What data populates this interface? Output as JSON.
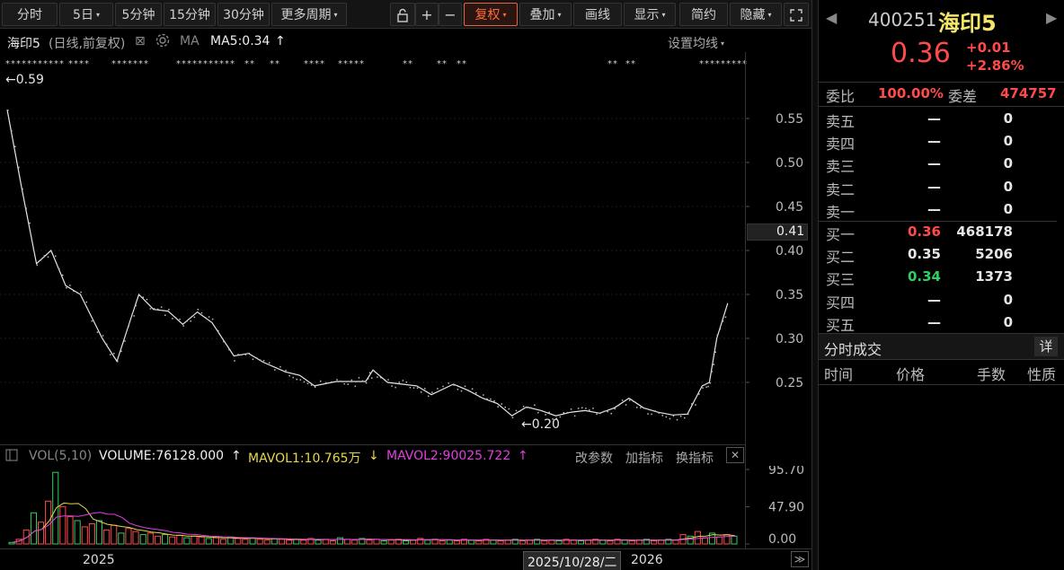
{
  "toolbar": {
    "items": [
      "分时",
      "5日",
      "5分钟",
      "15分钟",
      "30分钟",
      "更多周期",
      "复权",
      "叠加",
      "画线",
      "显示",
      "简约",
      "隐藏"
    ],
    "dropdown_marker": "▾",
    "lock_icon": "lock-icon",
    "plus": "+",
    "minus": "−",
    "fullscreen": "⛶"
  },
  "info": {
    "name": "海印5",
    "mode": "(日线,前复权)",
    "close_glyph": "⊠",
    "ma_label": "MA",
    "ma5": "MA5:0.34",
    "ma_arrow": "↑",
    "settings": "设置均线",
    "settings_arrow": "▾"
  },
  "markers": {
    "max_label": "←0.59",
    "min_label": "←0.20"
  },
  "price_axis": {
    "ticks": [
      "0.55",
      "0.50",
      "0.45",
      "0.40",
      "0.35",
      "0.30",
      "0.25"
    ],
    "current": "0.41"
  },
  "volume": {
    "label": "VOL(5,10)",
    "volume": "VOLUME:76128.000",
    "vol_arrow": "↑",
    "mavol1": "MAVOL1:10.765万",
    "mavol1_arrow": "↓",
    "mavol2": "MAVOL2:90025.722",
    "mavol2_arrow": "↑",
    "actions": [
      "改参数",
      "加指标",
      "换指标"
    ],
    "close": "✕",
    "ticks": [
      "95.70",
      "47.90",
      "0.00"
    ]
  },
  "dates": {
    "y1": "2025",
    "cursor": "2025/10/28/二",
    "y2": "2026",
    "next": "≫",
    "prev": "|"
  },
  "quote": {
    "code": "400251",
    "name": "海印5",
    "price": "0.36",
    "change": "+0.01",
    "change_pct": "+2.86%",
    "wb_label": "委比",
    "wb_value": "100.00%",
    "wc_label": "委差",
    "wc_value": "474757",
    "asks": [
      {
        "label": "卖五",
        "price": "—",
        "vol": "0"
      },
      {
        "label": "卖四",
        "price": "—",
        "vol": "0"
      },
      {
        "label": "卖三",
        "price": "—",
        "vol": "0"
      },
      {
        "label": "卖二",
        "price": "—",
        "vol": "0"
      },
      {
        "label": "卖一",
        "price": "—",
        "vol": "0"
      }
    ],
    "bids": [
      {
        "label": "买一",
        "price": "0.36",
        "vol": "468178"
      },
      {
        "label": "买二",
        "price": "0.35",
        "vol": "5206"
      },
      {
        "label": "买三",
        "price": "0.34",
        "vol": "1373"
      },
      {
        "label": "买四",
        "price": "—",
        "vol": "0"
      },
      {
        "label": "买五",
        "price": "—",
        "vol": "0"
      }
    ],
    "trades_title": "分时成交",
    "trades_detail": "详",
    "cols": [
      "时间",
      "价格",
      "手数",
      "性质"
    ],
    "nav_left": "◀",
    "nav_right": "▶"
  },
  "colors": {
    "up": "#ff4a4a",
    "down": "#2ed060",
    "accent": "#ff6b3a",
    "mavol1": "#e6d84a",
    "mavol2": "#e040e0"
  },
  "chart_data": {
    "type": "line",
    "ylim": [
      0.2,
      0.59
    ],
    "price_path": [
      [
        0.0,
        0.56
      ],
      [
        0.02,
        0.47
      ],
      [
        0.04,
        0.385
      ],
      [
        0.06,
        0.4
      ],
      [
        0.08,
        0.36
      ],
      [
        0.1,
        0.35
      ],
      [
        0.13,
        0.3
      ],
      [
        0.15,
        0.274
      ],
      [
        0.17,
        0.325
      ],
      [
        0.18,
        0.35
      ],
      [
        0.2,
        0.333
      ],
      [
        0.22,
        0.331
      ],
      [
        0.24,
        0.316
      ],
      [
        0.26,
        0.33
      ],
      [
        0.28,
        0.318
      ],
      [
        0.31,
        0.28
      ],
      [
        0.33,
        0.283
      ],
      [
        0.35,
        0.273
      ],
      [
        0.38,
        0.262
      ],
      [
        0.4,
        0.258
      ],
      [
        0.42,
        0.246
      ],
      [
        0.45,
        0.251
      ],
      [
        0.47,
        0.251
      ],
      [
        0.49,
        0.251
      ],
      [
        0.5,
        0.264
      ],
      [
        0.52,
        0.25
      ],
      [
        0.54,
        0.248
      ],
      [
        0.56,
        0.246
      ],
      [
        0.58,
        0.236
      ],
      [
        0.61,
        0.248
      ],
      [
        0.63,
        0.241
      ],
      [
        0.65,
        0.232
      ],
      [
        0.67,
        0.226
      ],
      [
        0.69,
        0.212
      ],
      [
        0.71,
        0.222
      ],
      [
        0.73,
        0.218
      ],
      [
        0.75,
        0.212
      ],
      [
        0.77,
        0.216
      ],
      [
        0.79,
        0.218
      ],
      [
        0.81,
        0.215
      ],
      [
        0.83,
        0.221
      ],
      [
        0.85,
        0.232
      ],
      [
        0.87,
        0.221
      ],
      [
        0.89,
        0.216
      ],
      [
        0.91,
        0.213
      ],
      [
        0.93,
        0.214
      ],
      [
        0.95,
        0.246
      ],
      [
        0.96,
        0.25
      ],
      [
        0.97,
        0.3
      ],
      [
        0.985,
        0.34
      ]
    ],
    "volume_bars": [
      2,
      6,
      18,
      40,
      28,
      55,
      92,
      48,
      35,
      30,
      22,
      26,
      30,
      18,
      24,
      14,
      20,
      16,
      12,
      14,
      10,
      12,
      9,
      11,
      8,
      10,
      9,
      7,
      8,
      6,
      9,
      7,
      6,
      8,
      6,
      5,
      7,
      6,
      5,
      6,
      5,
      7,
      5,
      6,
      4,
      8,
      6,
      5,
      7,
      5,
      6,
      4,
      5,
      6,
      4,
      5,
      7,
      5,
      6,
      4,
      5,
      4,
      6,
      5,
      4,
      6,
      5,
      4,
      5,
      6,
      4,
      5,
      6,
      4,
      5,
      4,
      6,
      5,
      4,
      5,
      6,
      5,
      4,
      6,
      5,
      4,
      5,
      6,
      4,
      5,
      6,
      5,
      12,
      10,
      16,
      8,
      14,
      9,
      12,
      10
    ],
    "vol_max": 95.7
  }
}
